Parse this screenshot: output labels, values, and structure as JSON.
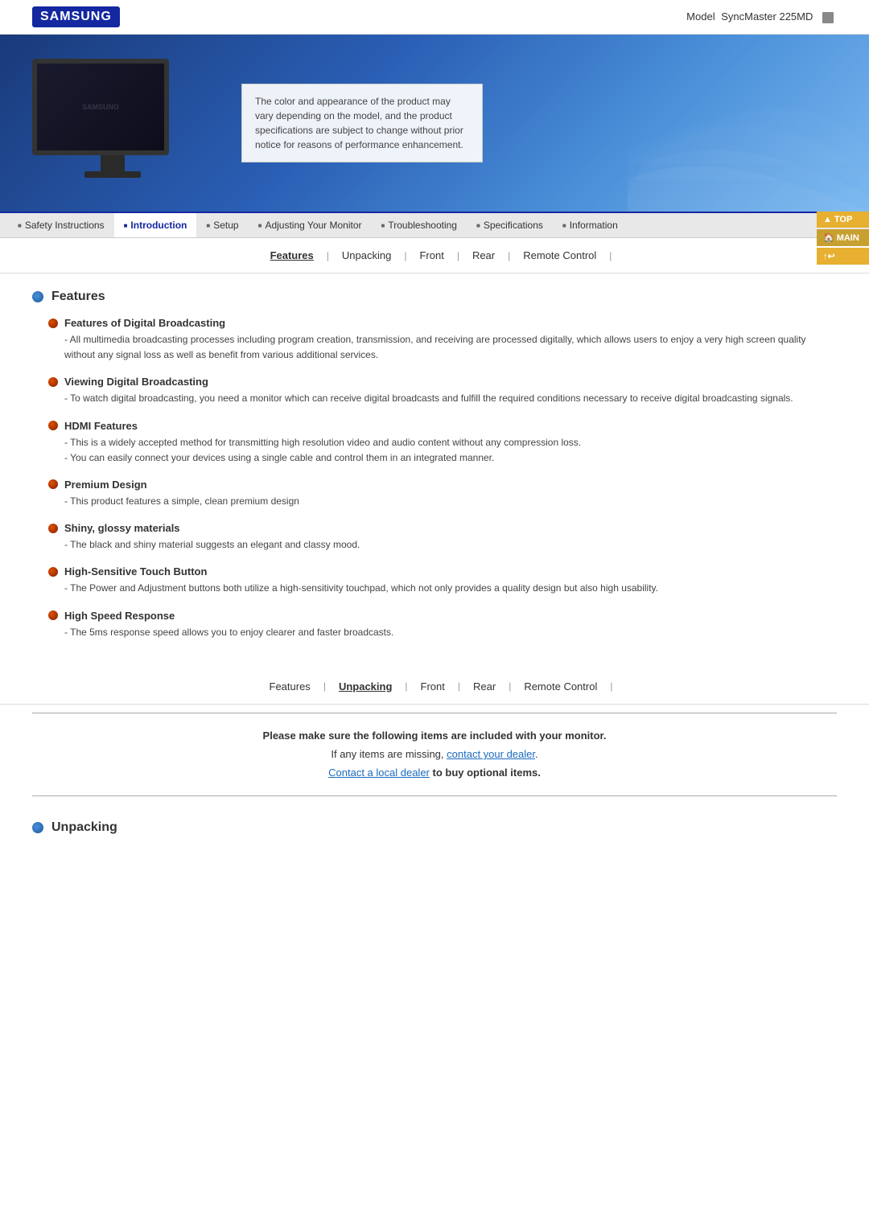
{
  "header": {
    "logo": "SAMSUNG",
    "model_label": "Model",
    "model_name": "SyncMaster 225MD"
  },
  "hero": {
    "tooltip_text": "The color and appearance of the product may vary depending on the model, and the product specifications are subject to change without prior notice for reasons of performance enhancement."
  },
  "nav": {
    "items": [
      {
        "id": "safety",
        "label": "Safety Instructions",
        "active": false
      },
      {
        "id": "introduction",
        "label": "Introduction",
        "active": true
      },
      {
        "id": "setup",
        "label": "Setup",
        "active": false
      },
      {
        "id": "adjusting",
        "label": "Adjusting Your Monitor",
        "active": false
      },
      {
        "id": "troubleshooting",
        "label": "Troubleshooting",
        "active": false
      },
      {
        "id": "specifications",
        "label": "Specifications",
        "active": false
      },
      {
        "id": "information",
        "label": "Information",
        "active": false
      }
    ]
  },
  "side_buttons": {
    "top": "TOP",
    "main": "MAIN",
    "back": "↑ ↩"
  },
  "sub_nav": {
    "items": [
      {
        "label": "Features",
        "active": false
      },
      {
        "label": "Unpacking",
        "active": false
      },
      {
        "label": "Front",
        "active": false
      },
      {
        "label": "Rear",
        "active": false
      },
      {
        "label": "Remote Control",
        "active": false
      }
    ]
  },
  "sub_nav2": {
    "items": [
      {
        "label": "Features",
        "active": false
      },
      {
        "label": "Unpacking",
        "active": true
      },
      {
        "label": "Front",
        "active": false
      },
      {
        "label": "Rear",
        "active": false
      },
      {
        "label": "Remote Control",
        "active": false
      }
    ]
  },
  "features_section": {
    "title": "Features",
    "items": [
      {
        "heading": "Features of Digital Broadcasting",
        "lines": [
          "All multimedia broadcasting processes including program creation, transmission, and receiving are processed digitally, which allows users to enjoy a very high screen quality without any signal loss as well as benefit from various additional services."
        ]
      },
      {
        "heading": "Viewing Digital Broadcasting",
        "lines": [
          "To watch digital broadcasting, you need a monitor which can receive digital broadcasts and fulfill the required conditions necessary to receive digital broadcasting signals."
        ]
      },
      {
        "heading": "HDMI Features",
        "lines": [
          "This is a widely accepted method for transmitting high resolution video and audio content without any compression loss.",
          "You can easily connect your devices using a single cable and control them in an integrated manner."
        ]
      },
      {
        "heading": "Premium Design",
        "lines": [
          "This product features a simple, clean premium design"
        ]
      },
      {
        "heading": "Shiny, glossy materials",
        "lines": [
          "The black and shiny material suggests an elegant and classy mood."
        ]
      },
      {
        "heading": "High-Sensitive Touch Button",
        "lines": [
          "The Power and Adjustment buttons both utilize a high-sensitivity touchpad, which not only provides a quality design but also high usability."
        ]
      },
      {
        "heading": "High Speed Response",
        "lines": [
          "The 5ms response speed allows you to enjoy clearer and faster broadcasts."
        ]
      }
    ]
  },
  "info_box": {
    "line1": "Please make sure the following items are included with your monitor.",
    "line2_before": "If any items are missing, ",
    "line2_link": "contact your dealer",
    "line2_after": ".",
    "line3_before": "Contact a local dealer ",
    "line3_bold": "to buy optional items.",
    "line3_link": "Contact a local dealer"
  },
  "unpacking_section": {
    "title": "Unpacking"
  }
}
